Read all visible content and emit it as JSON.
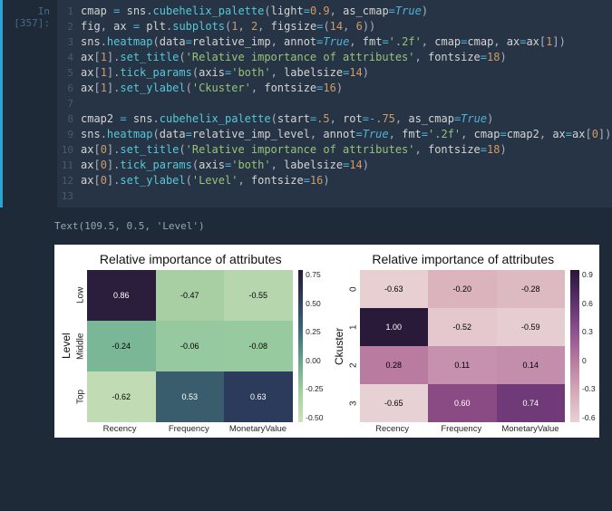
{
  "prompt": "In [357]:",
  "code_lines": [
    "cmap = sns.cubehelix_palette(light=0.9, as_cmap=True)",
    "fig, ax = plt.subplots(1, 2, figsize=(14, 6))",
    "sns.heatmap(data=relative_imp, annot=True, fmt='.2f', cmap=cmap, ax=ax[1])",
    "ax[1].set_title('Relative importance of attributes', fontsize=18)",
    "ax[1].tick_params(axis='both', labelsize=14)",
    "ax[1].set_ylabel('Ckuster', fontsize=16)",
    "",
    "cmap2 = sns.cubehelix_palette(start=.5, rot=-.75, as_cmap=True)",
    "sns.heatmap(data=relative_imp_level, annot=True, fmt='.2f', cmap=cmap2, ax=ax[0])",
    "ax[0].set_title('Relative importance of attributes', fontsize=18)",
    "ax[0].tick_params(axis='both', labelsize=14)",
    "ax[0].set_ylabel('Level', fontsize=16)",
    ""
  ],
  "output_text": "Text(109.5, 0.5, 'Level')",
  "chart_data": [
    {
      "type": "heatmap",
      "title": "Relative importance of attributes",
      "ylabel": "Level",
      "yticks": [
        "Low",
        "Middle",
        "Top"
      ],
      "xticks": [
        "Recency",
        "Frequency",
        "MonetaryValue"
      ],
      "grid": [
        [
          0.86,
          -0.47,
          -0.55
        ],
        [
          -0.24,
          -0.06,
          -0.08
        ],
        [
          -0.62,
          0.53,
          0.63
        ]
      ],
      "colorbar_ticks": [
        "0.75",
        "0.50",
        "0.25",
        "0.00",
        "-0.25",
        "-0.50"
      ],
      "cell_colors": [
        [
          "#2a1e3c",
          "#a7cfa3",
          "#b6d6ad"
        ],
        [
          "#7ab796",
          "#96c99f",
          "#98caa0"
        ],
        [
          "#c1dcb4",
          "#3a5d6e",
          "#2c3a5c"
        ]
      ],
      "text_colors": [
        [
          "#fff",
          "#000",
          "#000"
        ],
        [
          "#000",
          "#000",
          "#000"
        ],
        [
          "#000",
          "#fff",
          "#fff"
        ]
      ],
      "cbar_gradient": "linear-gradient(to bottom,#261a35,#2f3e5f,#3c6a77,#69a58d,#a3cfa1,#cde2ba)"
    },
    {
      "type": "heatmap",
      "title": "Relative importance of attributes",
      "ylabel": "Ckuster",
      "yticks": [
        "0",
        "1",
        "2",
        "3"
      ],
      "xticks": [
        "Recency",
        "Frequency",
        "MonetaryValue"
      ],
      "grid": [
        [
          -0.63,
          -0.2,
          -0.28
        ],
        [
          1.0,
          -0.52,
          -0.59
        ],
        [
          0.28,
          0.11,
          0.14
        ],
        [
          -0.65,
          0.6,
          0.74
        ]
      ],
      "colorbar_ticks": [
        "0.9",
        "0.6",
        "0.3",
        "0",
        "-0.3",
        "-0.6"
      ],
      "cell_colors": [
        [
          "#e7cfd2",
          "#dab3bc",
          "#ddbac2"
        ],
        [
          "#2a1a3a",
          "#e4c8cd",
          "#e6cdd1"
        ],
        [
          "#b97ba0",
          "#c591af",
          "#c38eac"
        ],
        [
          "#e8d1d4",
          "#8a4b85",
          "#6f3a77"
        ]
      ],
      "text_colors": [
        [
          "#000",
          "#000",
          "#000"
        ],
        [
          "#fff",
          "#000",
          "#000"
        ],
        [
          "#000",
          "#000",
          "#000"
        ],
        [
          "#000",
          "#fff",
          "#fff"
        ]
      ],
      "cbar_gradient": "linear-gradient(to bottom,#281736,#5a2f6c,#8e4f8f,#b97ba0,#d6a9ba,#e8d1d4)"
    }
  ]
}
